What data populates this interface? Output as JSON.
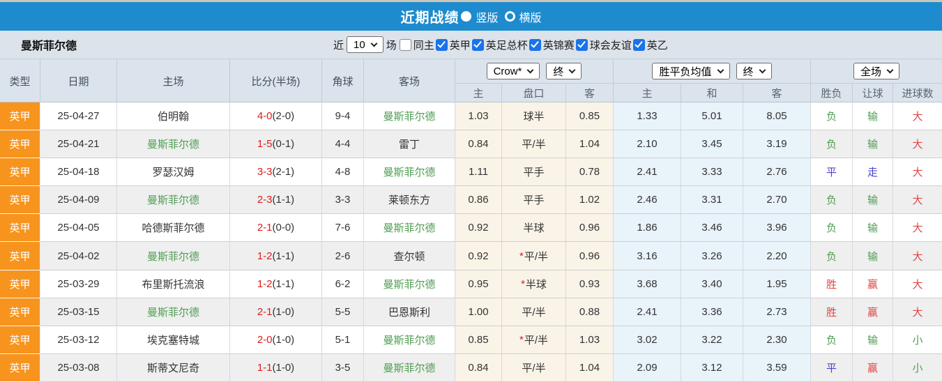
{
  "colors": {
    "topbar_bg": "#1d8bcd",
    "league_orange": "#f7941e",
    "score_red": "#e01b1b",
    "team_green": "#4f9d53",
    "result_red": "#e24444",
    "result_green": "#4f9d53",
    "result_blue": "#4a3fd0",
    "odds_bg": "#faf3e8",
    "avg_bg": "#e9f3fa",
    "checkbox_blue": "#1a73e8"
  },
  "topbar": {
    "title": "近期战绩",
    "radios": [
      {
        "label": "竖版",
        "selected": true
      },
      {
        "label": "横版",
        "selected": false
      }
    ]
  },
  "filterbar": {
    "team": "曼斯菲尔德",
    "recent_label": "近",
    "recent_value": "10",
    "games_label": "场",
    "checkboxes": [
      {
        "label": "同主",
        "checked": false
      },
      {
        "label": "英甲",
        "checked": true
      },
      {
        "label": "英足总杯",
        "checked": true
      },
      {
        "label": "英锦赛",
        "checked": true
      },
      {
        "label": "球会友谊",
        "checked": true
      },
      {
        "label": "英乙",
        "checked": true
      }
    ]
  },
  "table": {
    "columns": [
      "类型",
      "日期",
      "主场",
      "比分(半场)",
      "角球",
      "客场"
    ],
    "groups": {
      "odds_select": "Crow*",
      "odds_state_select": "终",
      "avg_select": "胜平负均值",
      "avg_state_select": "终",
      "scope_select": "全场"
    },
    "subheaders": [
      "主",
      "盘口",
      "客",
      "主",
      "和",
      "客",
      "胜负",
      "让球",
      "进球数"
    ],
    "result_color_map": {
      "胜": "red",
      "负": "green",
      "平": "blue",
      "赢": "red",
      "输": "green",
      "走": "blue",
      "大": "red",
      "小": "green"
    },
    "rows": [
      {
        "league": "英甲",
        "date": "25-04-27",
        "home": "伯明翰",
        "home_is_subject": false,
        "score": "4-0",
        "half": "(2-0)",
        "corners": "9-4",
        "away": "曼斯菲尔德",
        "away_is_subject": true,
        "odds_home": "1.03",
        "handicap": "球半",
        "handicap_star": false,
        "odds_away": "0.85",
        "avg_win": "1.33",
        "avg_draw": "5.01",
        "avg_lose": "8.05",
        "result": "负",
        "handicap_result": "输",
        "goals": "大"
      },
      {
        "league": "英甲",
        "date": "25-04-21",
        "home": "曼斯菲尔德",
        "home_is_subject": true,
        "score": "1-5",
        "half": "(0-1)",
        "corners": "4-4",
        "away": "雷丁",
        "away_is_subject": false,
        "odds_home": "0.84",
        "handicap": "平/半",
        "handicap_star": false,
        "odds_away": "1.04",
        "avg_win": "2.10",
        "avg_draw": "3.45",
        "avg_lose": "3.19",
        "result": "负",
        "handicap_result": "输",
        "goals": "大"
      },
      {
        "league": "英甲",
        "date": "25-04-18",
        "home": "罗瑟汉姆",
        "home_is_subject": false,
        "score": "3-3",
        "half": "(2-1)",
        "corners": "4-8",
        "away": "曼斯菲尔德",
        "away_is_subject": true,
        "odds_home": "1.11",
        "handicap": "平手",
        "handicap_star": false,
        "odds_away": "0.78",
        "avg_win": "2.41",
        "avg_draw": "3.33",
        "avg_lose": "2.76",
        "result": "平",
        "handicap_result": "走",
        "goals": "大"
      },
      {
        "league": "英甲",
        "date": "25-04-09",
        "home": "曼斯菲尔德",
        "home_is_subject": true,
        "score": "2-3",
        "half": "(1-1)",
        "corners": "3-3",
        "away": "莱顿东方",
        "away_is_subject": false,
        "odds_home": "0.86",
        "handicap": "平手",
        "handicap_star": false,
        "odds_away": "1.02",
        "avg_win": "2.46",
        "avg_draw": "3.31",
        "avg_lose": "2.70",
        "result": "负",
        "handicap_result": "输",
        "goals": "大"
      },
      {
        "league": "英甲",
        "date": "25-04-05",
        "home": "哈德斯菲尔德",
        "home_is_subject": false,
        "score": "2-1",
        "half": "(0-0)",
        "corners": "7-6",
        "away": "曼斯菲尔德",
        "away_is_subject": true,
        "odds_home": "0.92",
        "handicap": "半球",
        "handicap_star": false,
        "odds_away": "0.96",
        "avg_win": "1.86",
        "avg_draw": "3.46",
        "avg_lose": "3.96",
        "result": "负",
        "handicap_result": "输",
        "goals": "大"
      },
      {
        "league": "英甲",
        "date": "25-04-02",
        "home": "曼斯菲尔德",
        "home_is_subject": true,
        "score": "1-2",
        "half": "(1-1)",
        "corners": "2-6",
        "away": "查尔顿",
        "away_is_subject": false,
        "odds_home": "0.92",
        "handicap": "平/半",
        "handicap_star": true,
        "odds_away": "0.96",
        "avg_win": "3.16",
        "avg_draw": "3.26",
        "avg_lose": "2.20",
        "result": "负",
        "handicap_result": "输",
        "goals": "大"
      },
      {
        "league": "英甲",
        "date": "25-03-29",
        "home": "布里斯托流浪",
        "home_is_subject": false,
        "score": "1-2",
        "half": "(1-1)",
        "corners": "6-2",
        "away": "曼斯菲尔德",
        "away_is_subject": true,
        "odds_home": "0.95",
        "handicap": "半球",
        "handicap_star": true,
        "odds_away": "0.93",
        "avg_win": "3.68",
        "avg_draw": "3.40",
        "avg_lose": "1.95",
        "result": "胜",
        "handicap_result": "赢",
        "goals": "大"
      },
      {
        "league": "英甲",
        "date": "25-03-15",
        "home": "曼斯菲尔德",
        "home_is_subject": true,
        "score": "2-1",
        "half": "(1-0)",
        "corners": "5-5",
        "away": "巴恩斯利",
        "away_is_subject": false,
        "odds_home": "1.00",
        "handicap": "平/半",
        "handicap_star": false,
        "odds_away": "0.88",
        "avg_win": "2.41",
        "avg_draw": "3.36",
        "avg_lose": "2.73",
        "result": "胜",
        "handicap_result": "赢",
        "goals": "大"
      },
      {
        "league": "英甲",
        "date": "25-03-12",
        "home": "埃克塞特城",
        "home_is_subject": false,
        "score": "2-0",
        "half": "(1-0)",
        "corners": "5-1",
        "away": "曼斯菲尔德",
        "away_is_subject": true,
        "odds_home": "0.85",
        "handicap": "平/半",
        "handicap_star": true,
        "odds_away": "1.03",
        "avg_win": "3.02",
        "avg_draw": "3.22",
        "avg_lose": "2.30",
        "result": "负",
        "handicap_result": "输",
        "goals": "小"
      },
      {
        "league": "英甲",
        "date": "25-03-08",
        "home": "斯蒂文尼奇",
        "home_is_subject": false,
        "score": "1-1",
        "half": "(1-0)",
        "corners": "3-5",
        "away": "曼斯菲尔德",
        "away_is_subject": true,
        "odds_home": "0.84",
        "handicap": "平/半",
        "handicap_star": false,
        "odds_away": "1.04",
        "avg_win": "2.09",
        "avg_draw": "3.12",
        "avg_lose": "3.59",
        "result": "平",
        "handicap_result": "赢",
        "goals": "小"
      }
    ]
  }
}
